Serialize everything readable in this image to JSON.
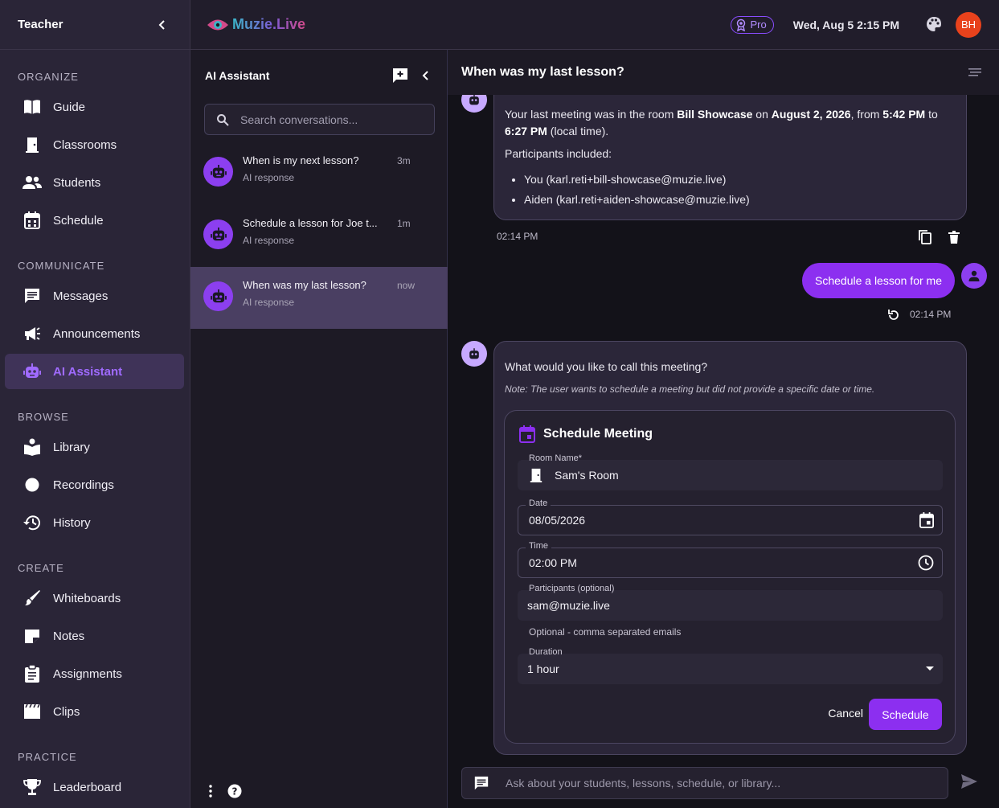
{
  "sidebar": {
    "title": "Teacher",
    "sections": {
      "organize": "ORGANIZE",
      "communicate": "COMMUNICATE",
      "browse": "BROWSE",
      "create": "CREATE",
      "practice": "PRACTICE"
    },
    "items": {
      "guide": "Guide",
      "classrooms": "Classrooms",
      "students": "Students",
      "schedule": "Schedule",
      "messages": "Messages",
      "announcements": "Announcements",
      "ai_assistant": "AI Assistant",
      "library": "Library",
      "recordings": "Recordings",
      "history": "History",
      "whiteboards": "Whiteboards",
      "notes": "Notes",
      "assignments": "Assignments",
      "clips": "Clips",
      "leaderboard": "Leaderboard"
    },
    "active_item": "ai_assistant"
  },
  "topbar": {
    "logo_text": "Muzie.Live",
    "pro_label": "Pro",
    "datetime": "Wed, Aug 5 2:15 PM",
    "avatar_initials": "BH"
  },
  "conversations": {
    "title": "AI Assistant",
    "search_placeholder": "Search conversations...",
    "items": [
      {
        "title": "When is my next lesson?",
        "subtitle": "AI response",
        "time": "3m"
      },
      {
        "title": "Schedule a lesson for Joe t...",
        "subtitle": "AI response",
        "time": "1m"
      },
      {
        "title": "When was my last lesson?",
        "subtitle": "AI response",
        "time": "now"
      }
    ],
    "active_index": 2
  },
  "chat": {
    "title": "When was my last lesson?",
    "message1": {
      "p1_a": "Your last meeting was in the room ",
      "p1_room": "Bill Showcase",
      "p1_b": " on ",
      "p1_date": "August 2, 2026",
      "p1_c": ", from ",
      "p1_start": "5:42 PM",
      "p1_d": " to ",
      "p1_end": "6:27 PM",
      "p1_e": " (local time).",
      "p2": "Participants included:",
      "participants": [
        "You (karl.reti+bill-showcase@muzie.live)",
        "Aiden (karl.reti+aiden-showcase@muzie.live)"
      ],
      "time": "02:14 PM"
    },
    "user_message": {
      "text": "Schedule a lesson for me",
      "time": "02:14 PM"
    },
    "message2": {
      "question": "What would you like to call this meeting?",
      "note": "Note: The user wants to schedule a meeting but did not provide a specific date or time."
    },
    "form": {
      "title": "Schedule Meeting",
      "room_label": "Room Name",
      "room_required": "*",
      "room_value": "Sam's Room",
      "date_label": "Date",
      "date_value": "08/05/2026",
      "time_label": "Time",
      "time_value": "02:00 PM",
      "participants_label": "Participants (optional)",
      "participants_value": "sam@muzie.live",
      "participants_helper": "Optional - comma separated emails",
      "duration_label": "Duration",
      "duration_value": "1 hour",
      "cancel_label": "Cancel",
      "schedule_label": "Schedule"
    },
    "composer_placeholder": "Ask about your students, lessons, schedule, or library..."
  },
  "colors": {
    "accent": "#8c2ff0",
    "active_nav_text": "#a06bff",
    "avatar_bg": "#e8421c"
  }
}
